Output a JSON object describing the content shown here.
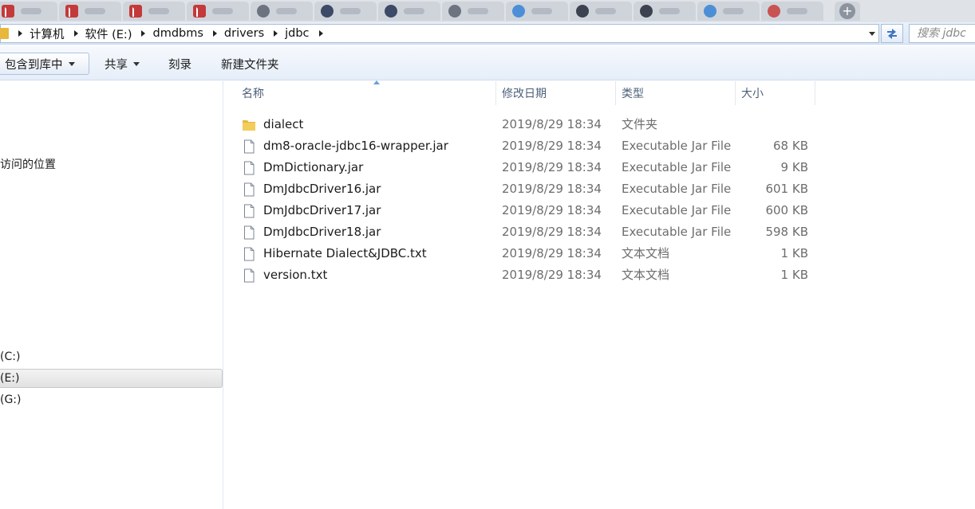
{
  "breadcrumbs": [
    "计算机",
    "软件 (E:)",
    "dmdbms",
    "drivers",
    "jdbc"
  ],
  "search": {
    "placeholder": "搜索 jdbc"
  },
  "toolbar": {
    "include_library": "包含到库中",
    "share": "共享",
    "burn": "刻录",
    "new_folder": "新建文件夹"
  },
  "nav": {
    "recent_places": "访问的位置",
    "drive_c": "(C:)",
    "drive_e": "(E:)",
    "drive_g": "(G:)"
  },
  "columns": {
    "name": "名称",
    "date": "修改日期",
    "type": "类型",
    "size": "大小"
  },
  "files": [
    {
      "name": "dialect",
      "date": "2019/8/29 18:34",
      "type": "文件夹",
      "size": "",
      "icon": "folder-icon"
    },
    {
      "name": "dm8-oracle-jdbc16-wrapper.jar",
      "date": "2019/8/29 18:34",
      "type": "Executable Jar File",
      "size": "68 KB",
      "icon": "jar-file-icon"
    },
    {
      "name": "DmDictionary.jar",
      "date": "2019/8/29 18:34",
      "type": "Executable Jar File",
      "size": "9 KB",
      "icon": "jar-file-icon"
    },
    {
      "name": "DmJdbcDriver16.jar",
      "date": "2019/8/29 18:34",
      "type": "Executable Jar File",
      "size": "601 KB",
      "icon": "jar-file-icon"
    },
    {
      "name": "DmJdbcDriver17.jar",
      "date": "2019/8/29 18:34",
      "type": "Executable Jar File",
      "size": "600 KB",
      "icon": "jar-file-icon"
    },
    {
      "name": "DmJdbcDriver18.jar",
      "date": "2019/8/29 18:34",
      "type": "Executable Jar File",
      "size": "598 KB",
      "icon": "jar-file-icon"
    },
    {
      "name": "Hibernate Dialect&JDBC.txt",
      "date": "2019/8/29 18:34",
      "type": "文本文档",
      "size": "1 KB",
      "icon": "text-file-icon"
    },
    {
      "name": "version.txt",
      "date": "2019/8/29 18:34",
      "type": "文本文档",
      "size": "1 KB",
      "icon": "text-file-icon"
    }
  ],
  "colors": {
    "header_text": "#4c607a",
    "folder": "#e8b73c",
    "toolbar_bg": "#e6eef9"
  }
}
